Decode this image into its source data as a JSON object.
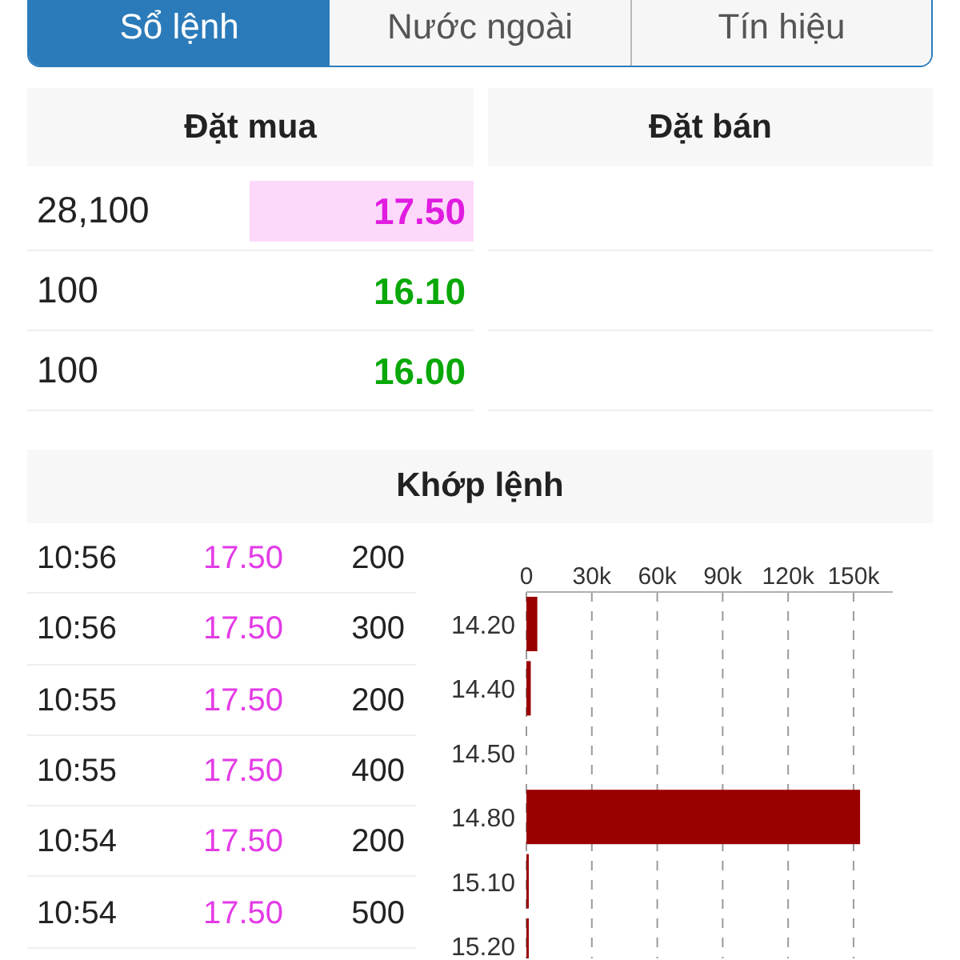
{
  "tabs": [
    {
      "label": "Sổ lệnh",
      "selected": true
    },
    {
      "label": "Nước ngoài",
      "selected": false
    },
    {
      "label": "Tín hiệu",
      "selected": false
    }
  ],
  "order_book": {
    "buy": {
      "title": "Đặt mua",
      "rows": [
        {
          "volume": "28,100",
          "price": "17.50",
          "color": "#e01ce0",
          "highlighted": true
        },
        {
          "volume": "100",
          "price": "16.10",
          "color": "#08a808",
          "highlighted": false
        },
        {
          "volume": "100",
          "price": "16.00",
          "color": "#08a808",
          "highlighted": false
        }
      ]
    },
    "sell": {
      "title": "Đặt bán"
    }
  },
  "matched": {
    "title": "Khớp lệnh",
    "trades": [
      {
        "time": "10:56",
        "price": "17.50",
        "volume": "200"
      },
      {
        "time": "10:56",
        "price": "17.50",
        "volume": "300"
      },
      {
        "time": "10:55",
        "price": "17.50",
        "volume": "200"
      },
      {
        "time": "10:55",
        "price": "17.50",
        "volume": "400"
      },
      {
        "time": "10:54",
        "price": "17.50",
        "volume": "200"
      },
      {
        "time": "10:54",
        "price": "17.50",
        "volume": "500"
      }
    ],
    "chart_data": {
      "type": "bar",
      "orientation": "horizontal",
      "grid": true,
      "categories": [
        "14.20",
        "14.40",
        "14.50",
        "14.80",
        "15.10",
        "15.20"
      ],
      "values": [
        5000,
        2000,
        0,
        153000,
        500,
        1000
      ],
      "xlim": [
        0,
        168000
      ],
      "xticks": [
        {
          "value": 0,
          "label": "0"
        },
        {
          "value": 30000,
          "label": "30k"
        },
        {
          "value": 60000,
          "label": "60k"
        },
        {
          "value": 90000,
          "label": "90k"
        },
        {
          "value": 120000,
          "label": "120k"
        },
        {
          "value": 150000,
          "label": "150k"
        }
      ]
    }
  }
}
